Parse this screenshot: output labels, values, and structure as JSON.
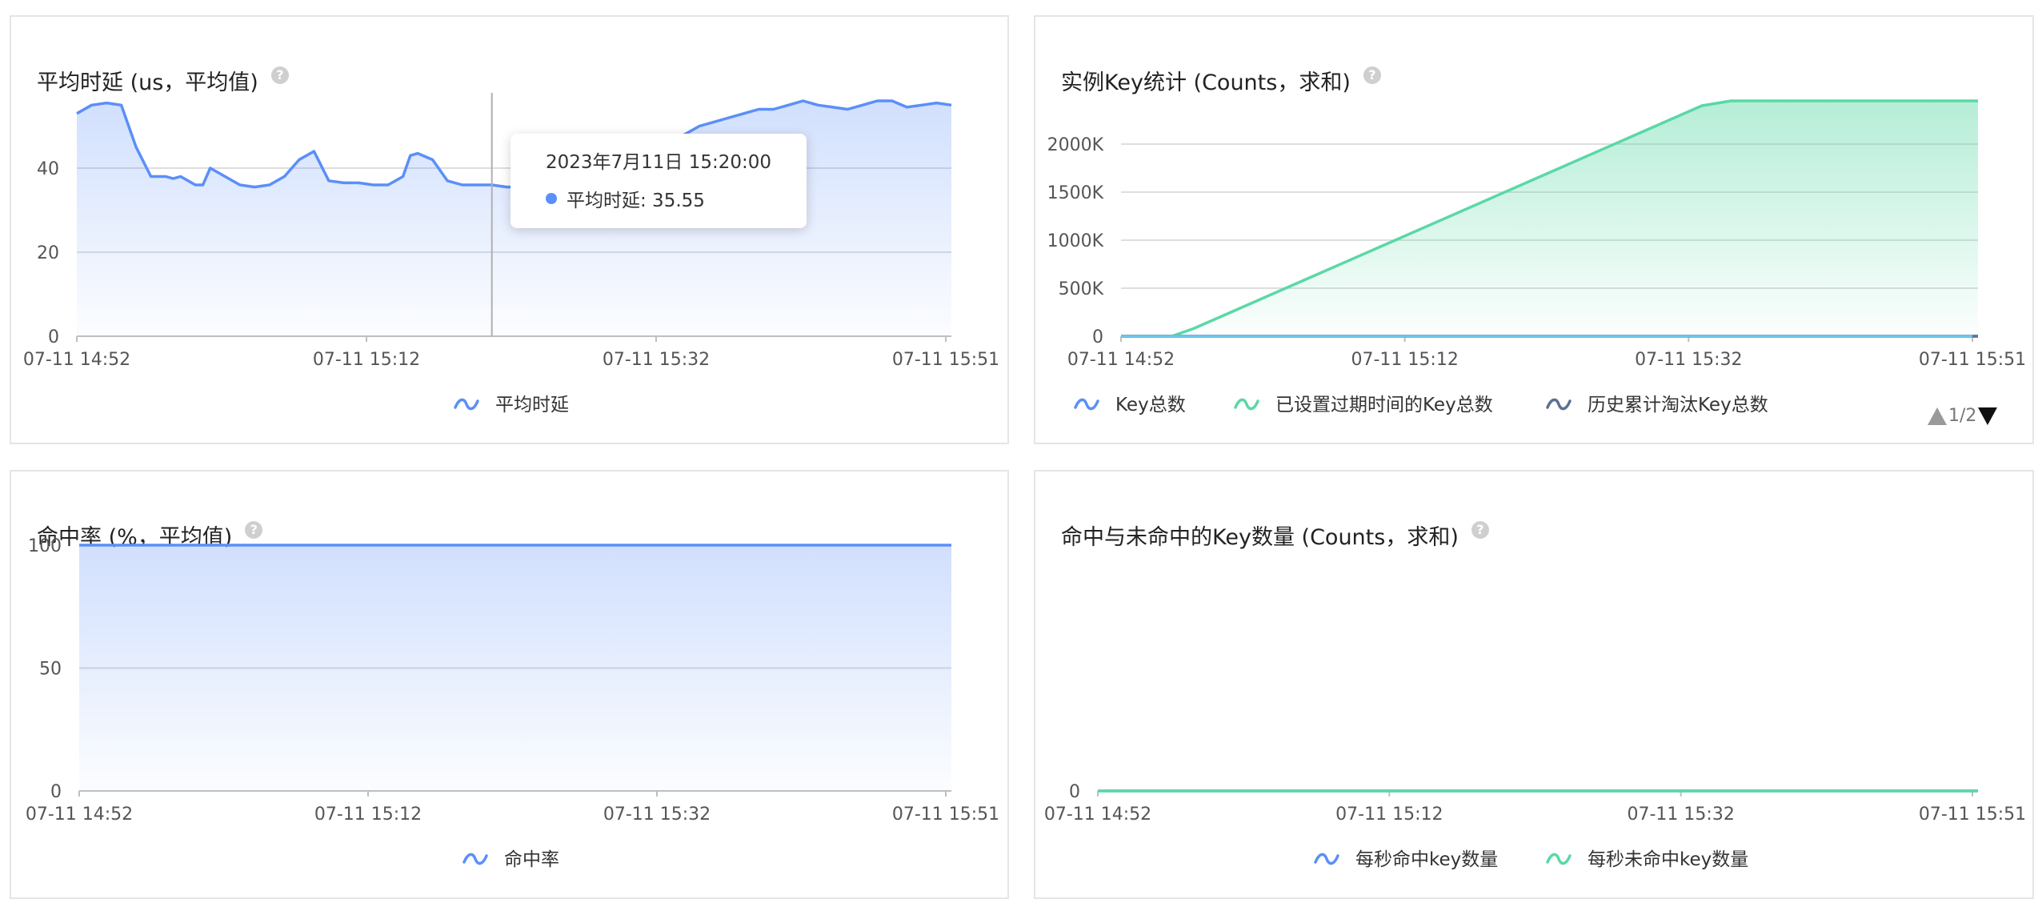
{
  "panels": [
    {
      "title": "平均时延 (us，平均值)",
      "help": "?"
    },
    {
      "title": "实例Key统计 (Counts，求和)",
      "help": "?"
    },
    {
      "title": "命中率 (%，平均值)",
      "help": "?"
    },
    {
      "title": "命中与未命中的Key数量 (Counts，求和)",
      "help": "?"
    }
  ],
  "tooltip": {
    "time": "2023年7月11日 15:20:00",
    "label": "平均时延: 35.55",
    "color": "#5b8ff9"
  },
  "pager": {
    "text": "1/2"
  },
  "chart_data": [
    {
      "type": "area",
      "title": "平均时延 (us，平均值)",
      "x_ticks": [
        "07-11 14:52",
        "07-11 15:12",
        "07-11 15:32",
        "07-11 15:51"
      ],
      "x_range": [
        0,
        59
      ],
      "ylim": [
        0,
        56
      ],
      "y_ticks": [
        {
          "v": 0,
          "label": "0"
        },
        {
          "v": 20,
          "label": "20"
        },
        {
          "v": 40,
          "label": "40"
        }
      ],
      "grid": true,
      "legend_position": "bottom",
      "crosshair_x": 28,
      "series": [
        {
          "name": "平均时延",
          "color": "#5b8ff9",
          "fill": true,
          "x": [
            0,
            1,
            2,
            3,
            3.5,
            4,
            5,
            6,
            6.5,
            7,
            8,
            8.5,
            9,
            10,
            11,
            12,
            13,
            14,
            15,
            16,
            17,
            18,
            19,
            20,
            21,
            22,
            22.5,
            23,
            24,
            25,
            26,
            27,
            28,
            29,
            30,
            31,
            32,
            33,
            34,
            35,
            36,
            37,
            38,
            39,
            40,
            41,
            42,
            43,
            44,
            45,
            46,
            47,
            48,
            49,
            50,
            51,
            52,
            53,
            54,
            55,
            56,
            57,
            58,
            59
          ],
          "y": [
            53,
            55,
            55.5,
            55,
            50,
            45,
            38,
            38,
            37.5,
            38,
            36,
            36,
            40,
            38,
            36,
            35.5,
            36,
            38,
            42,
            44,
            37,
            36.5,
            36.5,
            36,
            36,
            38,
            43,
            43.5,
            42,
            37,
            36,
            36,
            36,
            35.5,
            35.5,
            36,
            36,
            37,
            38,
            39,
            40,
            41,
            43,
            45,
            47,
            48,
            50,
            51,
            52,
            53,
            54,
            54,
            55,
            56,
            55,
            54.5,
            54,
            55,
            56,
            56,
            54.5,
            55,
            55.5,
            55
          ]
        }
      ]
    },
    {
      "type": "area",
      "title": "实例Key统计 (Counts，求和)",
      "x_ticks": [
        "07-11 14:52",
        "07-11 15:12",
        "07-11 15:32",
        "07-11 15:51"
      ],
      "x_range": [
        0,
        59
      ],
      "ylim": [
        0,
        2450
      ],
      "y_ticks": [
        {
          "v": 0,
          "label": "0"
        },
        {
          "v": 500,
          "label": "500K"
        },
        {
          "v": 1000,
          "label": "1000K"
        },
        {
          "v": 1500,
          "label": "1500K"
        },
        {
          "v": 2000,
          "label": "2000K"
        }
      ],
      "grid": true,
      "legend_position": "bottom",
      "series": [
        {
          "name": "Key总数",
          "color": "#5b8ff9",
          "fill": false,
          "x": [
            0,
            59
          ],
          "y": [
            0,
            0
          ]
        },
        {
          "name": "已设置过期时间的Key总数",
          "color": "#5ad8a6",
          "fill": true,
          "x": [
            0,
            3.5,
            5,
            40,
            42,
            59
          ],
          "y": [
            0,
            0,
            80,
            2400,
            2450,
            2450
          ]
        },
        {
          "name": "历史累计淘汰Key总数",
          "color": "#5d7092",
          "fill": false,
          "x": [
            0,
            59
          ],
          "y": [
            0,
            0
          ]
        }
      ]
    },
    {
      "type": "area",
      "title": "命中率 (%，平均值)",
      "x_ticks": [
        "07-11 14:52",
        "07-11 15:12",
        "07-11 15:32",
        "07-11 15:51"
      ],
      "x_range": [
        0,
        59
      ],
      "ylim": [
        0,
        100
      ],
      "y_ticks": [
        {
          "v": 0,
          "label": "0"
        },
        {
          "v": 50,
          "label": "50"
        },
        {
          "v": 100,
          "label": "100"
        }
      ],
      "grid": true,
      "legend_position": "bottom",
      "series": [
        {
          "name": "命中率",
          "color": "#5b8ff9",
          "fill": true,
          "x": [
            0,
            59
          ],
          "y": [
            100,
            100
          ]
        }
      ]
    },
    {
      "type": "line",
      "title": "命中与未命中的Key数量 (Counts，求和)",
      "x_ticks": [
        "07-11 14:52",
        "07-11 15:12",
        "07-11 15:32",
        "07-11 15:51"
      ],
      "x_range": [
        0,
        59
      ],
      "ylim": [
        0,
        1
      ],
      "y_ticks": [
        {
          "v": 0,
          "label": "0"
        }
      ],
      "grid": true,
      "legend_position": "bottom",
      "series": [
        {
          "name": "每秒命中key数量",
          "color": "#5b8ff9",
          "fill": false,
          "x": [
            0,
            59
          ],
          "y": [
            0,
            0
          ]
        },
        {
          "name": "每秒未命中key数量",
          "color": "#5ad8a6",
          "fill": false,
          "x": [
            0,
            59
          ],
          "y": [
            0,
            0
          ]
        }
      ]
    }
  ]
}
